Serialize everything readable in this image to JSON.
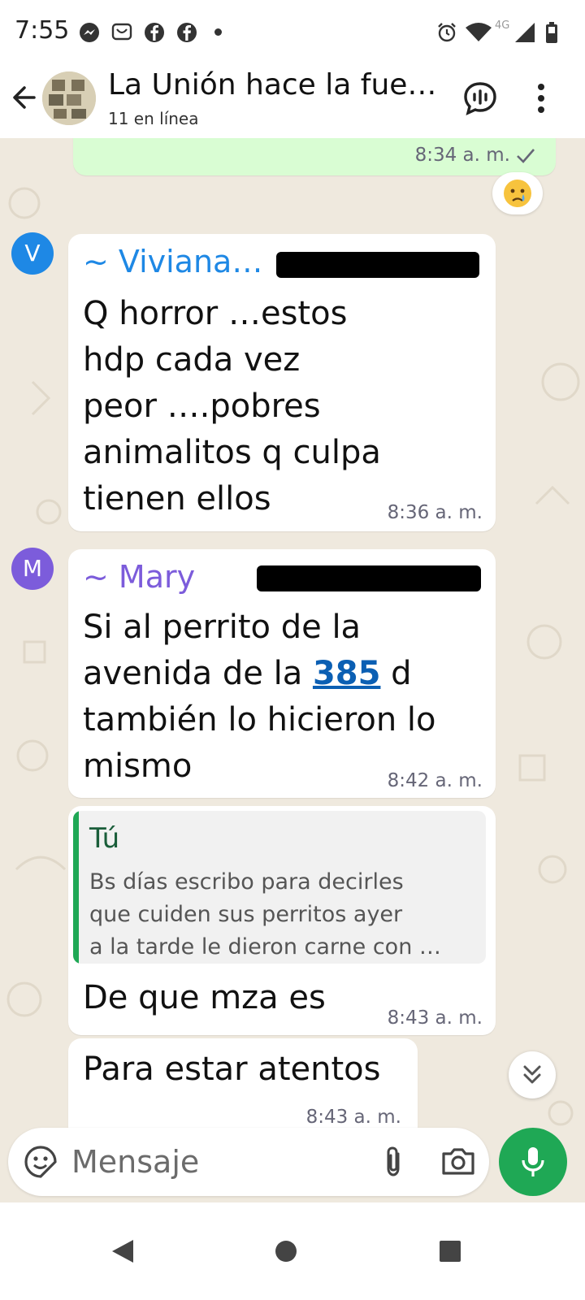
{
  "status_bar": {
    "time": "7:55",
    "network": "4G",
    "icons": [
      "messenger-icon",
      "notification-icon",
      "facebook-icon",
      "facebook-icon",
      "dot-icon",
      "alarm-icon",
      "wifi-icon",
      "signal-icon",
      "battery-icon"
    ]
  },
  "header": {
    "title": "La Unión hace la fue…",
    "subtitle": "11 en línea"
  },
  "messages": {
    "out_prev": {
      "time": "8:34 a. m.",
      "status": "sent-check-icon",
      "reaction": "😢"
    },
    "m1": {
      "avatar": "V",
      "sender": "~ Viviana…",
      "lines": [
        "Q horror …estos",
        "hdp cada vez",
        "peor ….pobres",
        "animalitos q culpa",
        "tienen ellos"
      ],
      "time": "8:36 a. m."
    },
    "m2": {
      "avatar": "M",
      "sender": "~ Mary",
      "line1": "Si al perrito de la",
      "line2_pre": "avenida de la ",
      "line2_link": "385",
      "line2_post": " d",
      "line3": "también lo hicieron lo",
      "line4": "mismo",
      "time": "8:42 a. m."
    },
    "m3": {
      "quote_author": "Tú",
      "quote_lines": [
        "Bs días escribo para decirles",
        "que cuiden sus perritos ayer",
        "a la tarde le dieron carne con …"
      ],
      "text": "De que mza es",
      "time": "8:43 a. m."
    },
    "m4": {
      "text": "Para estar atentos",
      "time": "8:43 a. m."
    }
  },
  "composer": {
    "placeholder": "Mensaje"
  },
  "colors": {
    "accent_green": "#1fa855",
    "outgoing_bubble": "#d9fdd3",
    "chat_background": "#efe9de",
    "sender_viviana": "#1e88e5",
    "sender_mary": "#7c5cdb",
    "link": "#0b5fb3"
  }
}
